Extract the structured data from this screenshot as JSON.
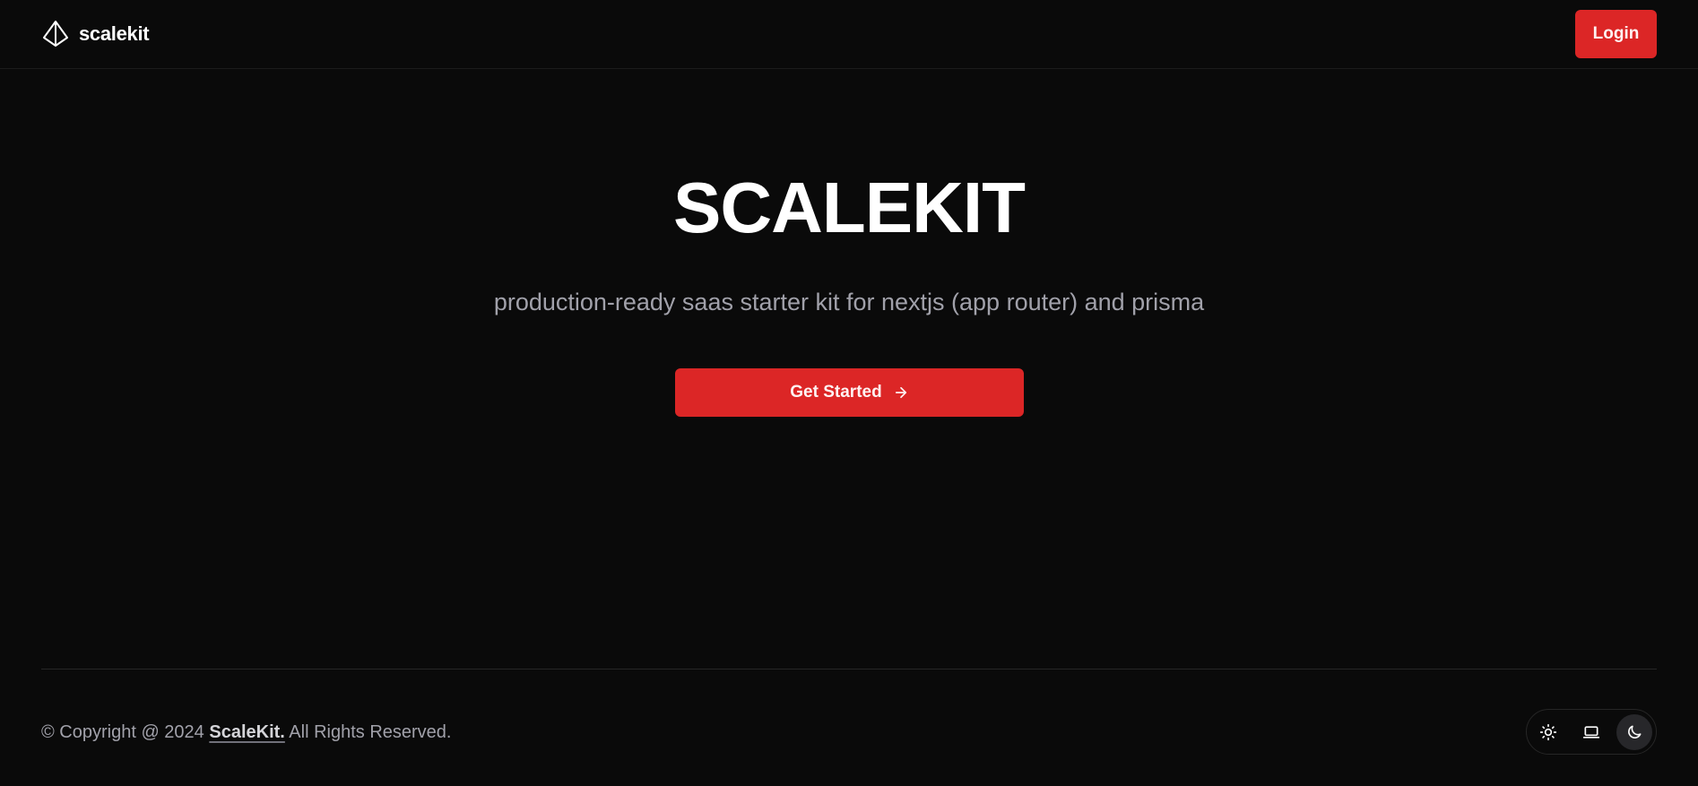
{
  "header": {
    "brand_name": "scalekit",
    "brand_icon": "pyramid-logo-icon",
    "login_label": "Login"
  },
  "hero": {
    "title": "SCALEKIT",
    "subtitle": "production-ready saas starter kit for nextjs (app router) and prisma",
    "cta_label": "Get Started",
    "cta_icon": "arrow-right-icon"
  },
  "footer": {
    "copyright_prefix": "© Copyright @ 2024",
    "company_link": "ScaleKit.",
    "copyright_suffix": "All Rights Reserved."
  },
  "theme_switcher": {
    "options": [
      {
        "icon": "sun-icon",
        "active": false
      },
      {
        "icon": "laptop-icon",
        "active": false
      },
      {
        "icon": "moon-icon",
        "active": true
      }
    ]
  },
  "colors": {
    "background": "#0a0a0a",
    "accent": "#dc2626",
    "muted_text": "#a1a1aa",
    "border": "#262626"
  }
}
